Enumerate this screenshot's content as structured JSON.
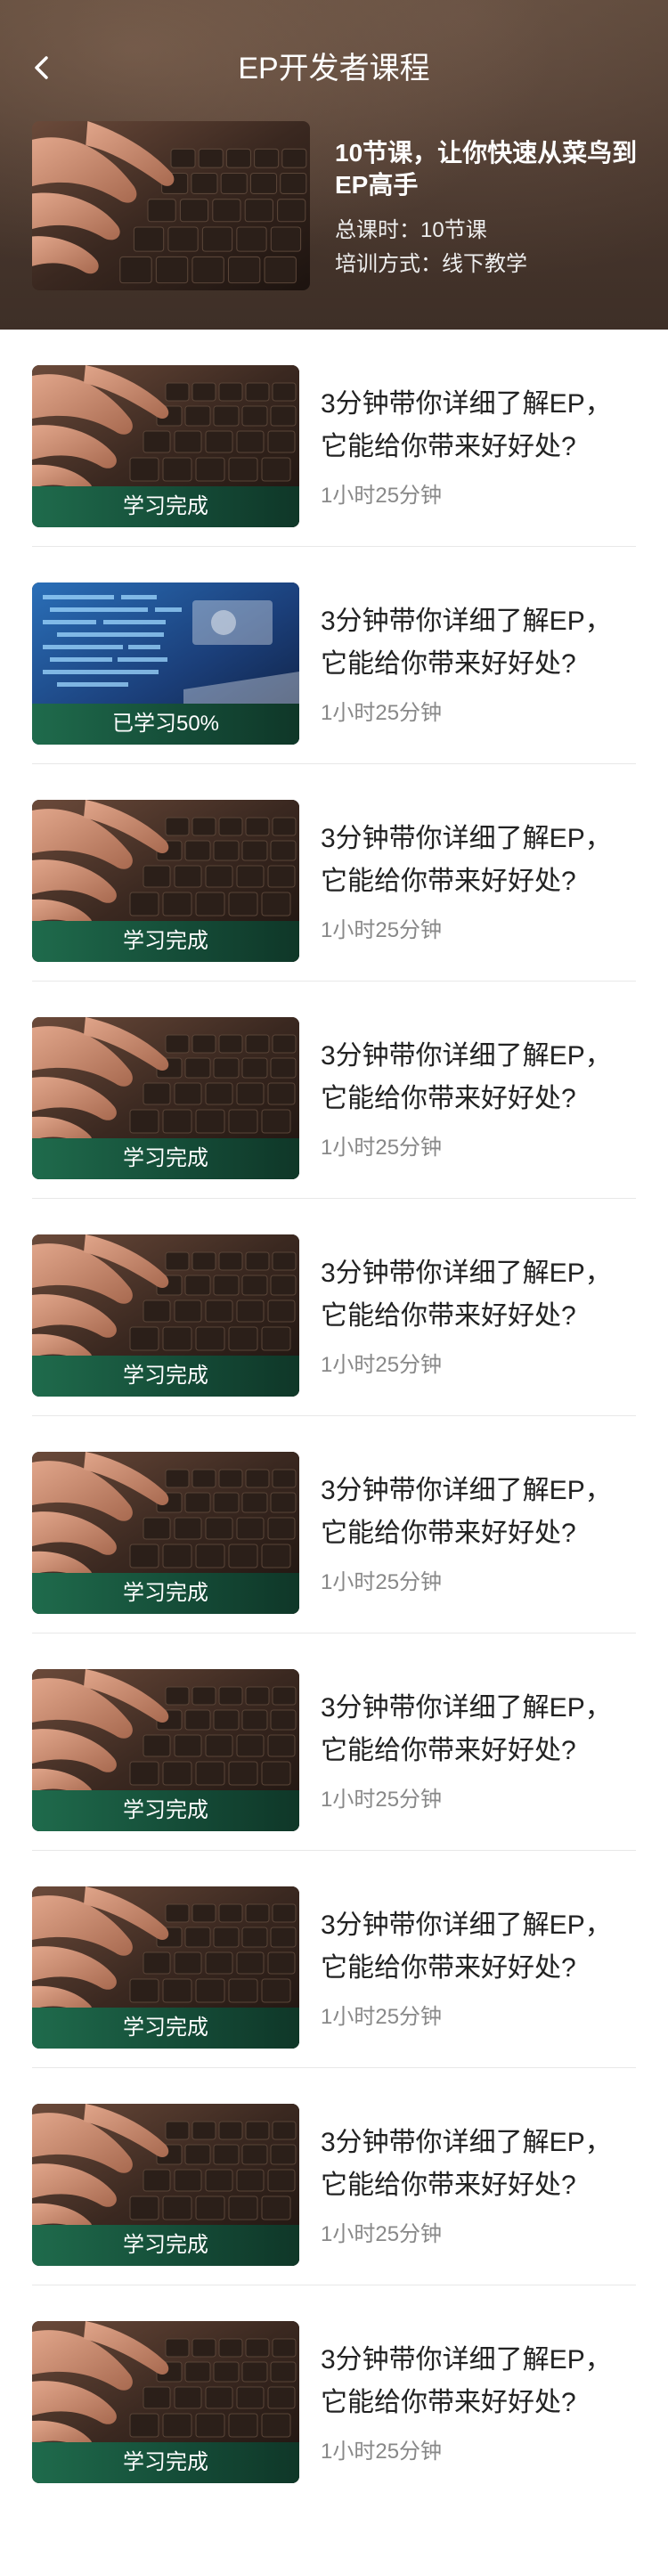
{
  "header": {
    "title": "EP开发者课程",
    "back_icon": "chevron-left-icon",
    "course_title": "10节课，让你快速从菜鸟到EP高手",
    "total_lessons": "总课时：10节课",
    "training_mode": "培训方式：线下教学"
  },
  "colors": {
    "header_bg": "#4a382e",
    "progress_band": "#1f6b4c",
    "title_text": "#222222",
    "meta_text": "#888888"
  },
  "lessons": [
    {
      "title": "3分钟带你详细了解EP，它能给你带来好好处?",
      "duration": "1小时25分钟",
      "status": "学习完成",
      "thumb": "keyboard-photo"
    },
    {
      "title": "3分钟带你详细了解EP，它能给你带来好好处?",
      "duration": "1小时25分钟",
      "status": "已学习50%",
      "thumb": "code-screen-photo"
    },
    {
      "title": "3分钟带你详细了解EP，它能给你带来好好处?",
      "duration": "1小时25分钟",
      "status": "学习完成",
      "thumb": "keyboard-photo"
    },
    {
      "title": "3分钟带你详细了解EP，它能给你带来好好处?",
      "duration": "1小时25分钟",
      "status": "学习完成",
      "thumb": "keyboard-photo"
    },
    {
      "title": "3分钟带你详细了解EP，它能给你带来好好处?",
      "duration": "1小时25分钟",
      "status": "学习完成",
      "thumb": "keyboard-photo"
    },
    {
      "title": "3分钟带你详细了解EP，它能给你带来好好处?",
      "duration": "1小时25分钟",
      "status": "学习完成",
      "thumb": "keyboard-photo"
    },
    {
      "title": "3分钟带你详细了解EP，它能给你带来好好处?",
      "duration": "1小时25分钟",
      "status": "学习完成",
      "thumb": "keyboard-photo"
    },
    {
      "title": "3分钟带你详细了解EP，它能给你带来好好处?",
      "duration": "1小时25分钟",
      "status": "学习完成",
      "thumb": "keyboard-photo"
    },
    {
      "title": "3分钟带你详细了解EP，它能给你带来好好处?",
      "duration": "1小时25分钟",
      "status": "学习完成",
      "thumb": "keyboard-photo"
    },
    {
      "title": "3分钟带你详细了解EP，它能给你带来好好处?",
      "duration": "1小时25分钟",
      "status": "学习完成",
      "thumb": "keyboard-photo"
    }
  ]
}
